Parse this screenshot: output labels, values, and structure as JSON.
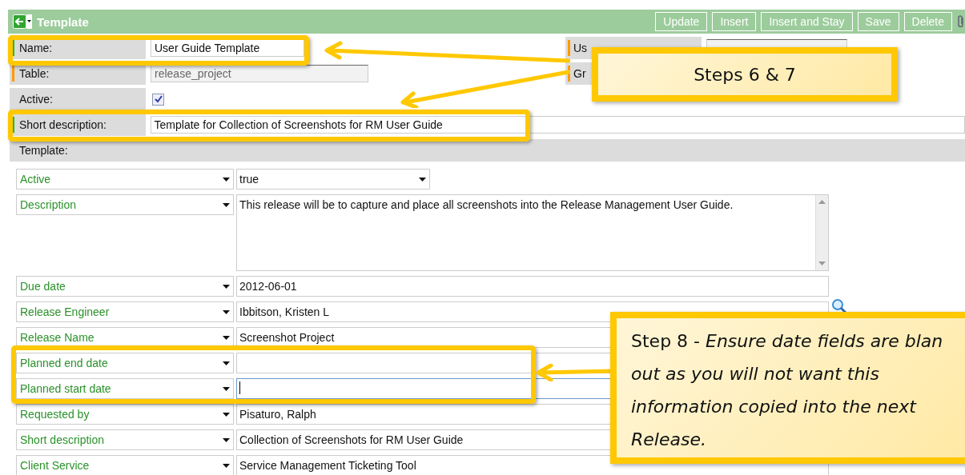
{
  "header": {
    "title": "Template",
    "buttons": [
      "Update",
      "Insert",
      "Insert and Stay",
      "Save",
      "Delete"
    ]
  },
  "form": {
    "left_rows": [
      {
        "label": "Name:",
        "color": "#22bb22",
        "kind": "text",
        "value": "User Guide Template"
      },
      {
        "label": "Table:",
        "color": "#ff9900",
        "kind": "readonly",
        "value": "release_project"
      }
    ],
    "right_rows": [
      {
        "label": "Us",
        "color": "#ff9900"
      },
      {
        "label": "Gr",
        "color": "#ff9900"
      }
    ],
    "rows": [
      {
        "label": "Active:",
        "kind": "checkbox",
        "checked": true
      },
      {
        "label": "Short description:",
        "color": "#22bb22",
        "kind": "text",
        "value": "Template for Collection of Screenshots for RM User Guide"
      }
    ]
  },
  "template": {
    "label": "Template:",
    "conditions": [
      {
        "field": "Active",
        "kind": "select",
        "value": "true"
      },
      {
        "field": "Description",
        "kind": "textarea",
        "value": "This release will be to capture and place all screenshots into the Release Management User Guide."
      },
      {
        "field": "Due date",
        "kind": "text",
        "value": "2012-06-01"
      },
      {
        "field": "Release Engineer",
        "kind": "reference",
        "value": "Ibbitson, Kristen L"
      },
      {
        "field": "Release Name",
        "kind": "text",
        "value": "Screenshot Project"
      },
      {
        "field": "Planned end date",
        "kind": "text",
        "focused": false
      },
      {
        "field": "Planned start date",
        "kind": "text",
        "focused": true
      },
      {
        "field": "Requested by",
        "kind": "text",
        "value": "Pisaturo, Ralph"
      },
      {
        "field": "Short description",
        "kind": "text",
        "value": "Collection of Screenshots for RM User Guide"
      },
      {
        "field": "Client Service",
        "kind": "text",
        "value": "Service Management Ticketing Tool"
      }
    ]
  },
  "callouts": [
    {
      "text": "Steps 6 & 7"
    },
    {
      "text": "Step 8 - *Ensure date fields are blan*"
    },
    {
      "text": "*out as you will not want this*"
    },
    {
      "text": "*information copied into the next*"
    },
    {
      "text": "*Release.*"
    }
  ]
}
